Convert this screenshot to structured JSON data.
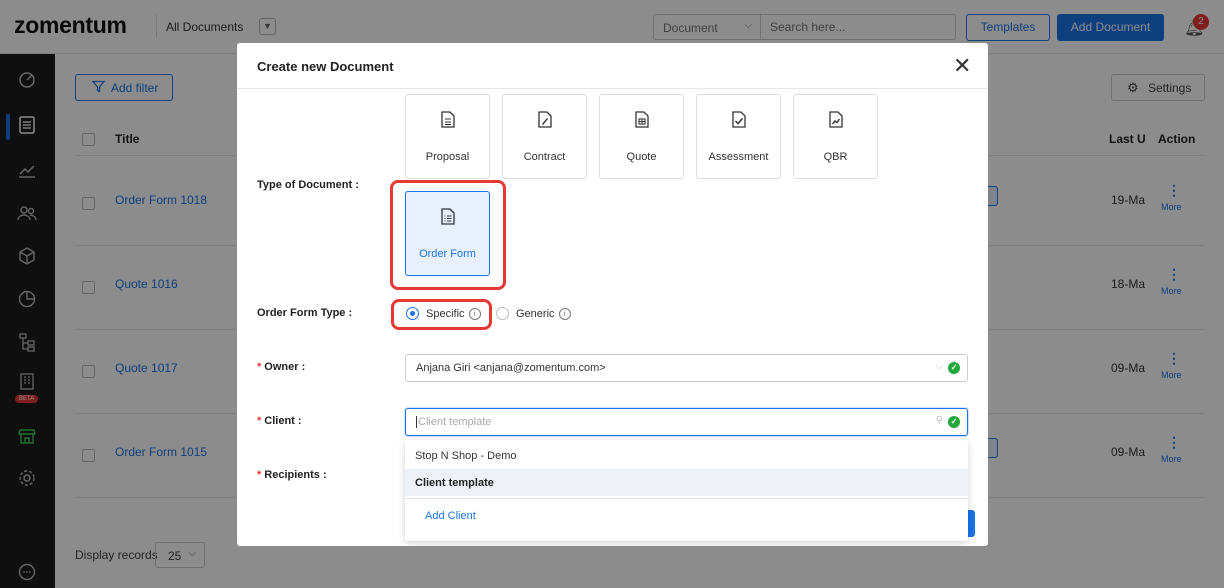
{
  "topbar": {
    "logo": "zomentum",
    "view_selector": "All Documents",
    "search_type": "Document",
    "search_placeholder": "Search here...",
    "templates_label": "Templates",
    "add_document_label": "Add Document",
    "notification_count": "2"
  },
  "sidebar": {
    "beta_label": "BETA"
  },
  "main": {
    "add_filter_label": "Add filter",
    "settings_label": "Settings",
    "columns": {
      "title": "Title",
      "last_updated": "Last U",
      "action": "Action"
    },
    "rows": [
      {
        "title": "Order Form 1018",
        "date": "19-Ma",
        "more": "More"
      },
      {
        "title": "Quote 1016",
        "date": "18-Ma",
        "more": "More"
      },
      {
        "title": "Quote 1017",
        "date": "09-Ma",
        "more": "More"
      },
      {
        "title": "Order Form 1015",
        "date": "09-Ma",
        "more": "More"
      }
    ],
    "display_records_label": "Display records",
    "display_records_value": "25"
  },
  "modal": {
    "title": "Create new Document",
    "type_label": "Type of Document :",
    "doc_types": [
      {
        "label": "Proposal",
        "icon": "document-icon"
      },
      {
        "label": "Contract",
        "icon": "signed-document-icon"
      },
      {
        "label": "Quote",
        "icon": "calculator-document-icon"
      },
      {
        "label": "Assessment",
        "icon": "check-document-icon"
      },
      {
        "label": "QBR",
        "icon": "chart-document-icon"
      },
      {
        "label": "Order Form",
        "icon": "list-document-icon",
        "selected": true
      }
    ],
    "order_form_type_label": "Order Form Type :",
    "order_form_types": [
      {
        "label": "Specific",
        "selected": true
      },
      {
        "label": "Generic",
        "selected": false
      }
    ],
    "owner_label": "Owner :",
    "owner_value": "Anjana Giri <anjana@zomentum.com>",
    "client_label": "Client :",
    "client_placeholder": "Client template",
    "recipients_label": "Recipients :",
    "client_options": [
      "Stop N Shop - Demo",
      "Client template"
    ],
    "add_client_label": "Add Client"
  },
  "colors": {
    "accent": "#1a73e8",
    "highlight": "#e53935",
    "success": "#22a83a"
  }
}
